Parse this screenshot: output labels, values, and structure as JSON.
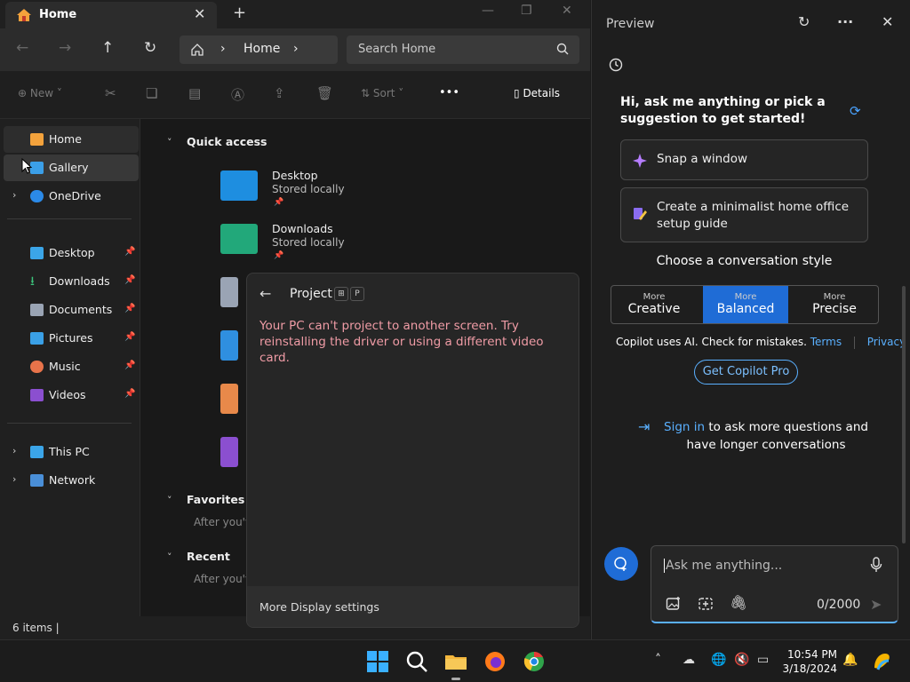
{
  "explorer": {
    "tab_title": "Home",
    "address": {
      "root": "Home"
    },
    "search_placeholder": "Search Home",
    "toolbar": {
      "new": "New",
      "sort": "Sort",
      "more": "•••",
      "details": "Details"
    },
    "nav": {
      "top": [
        {
          "label": "Home"
        },
        {
          "label": "Gallery"
        },
        {
          "label": "OneDrive"
        }
      ],
      "pinned": [
        {
          "label": "Desktop"
        },
        {
          "label": "Downloads"
        },
        {
          "label": "Documents"
        },
        {
          "label": "Pictures"
        },
        {
          "label": "Music"
        },
        {
          "label": "Videos"
        }
      ],
      "bottom": [
        {
          "label": "This PC"
        },
        {
          "label": "Network"
        }
      ]
    },
    "quick_access": {
      "title": "Quick access",
      "items": [
        {
          "name": "Desktop",
          "sub": "Stored locally"
        },
        {
          "name": "Downloads",
          "sub": "Stored locally"
        }
      ]
    },
    "favorites": {
      "title": "Favorites",
      "sub": "After you'v"
    },
    "recent": {
      "title": "Recent",
      "sub": "After you'v"
    },
    "status": "6 items  |"
  },
  "project": {
    "title": "Project",
    "key": "P",
    "error": "Your PC can't project to another screen. Try reinstalling the driver or using a different video card.",
    "footer": "More Display settings"
  },
  "copilot": {
    "title": "Preview",
    "more": "···",
    "greeting": "Hi, ask me anything or pick a suggestion to get started!",
    "suggestions": [
      {
        "text": "Snap a window"
      },
      {
        "text": "Create a minimalist home office setup guide"
      }
    ],
    "style_title": "Choose a conversation style",
    "styles": [
      {
        "more": "More",
        "name": "Creative"
      },
      {
        "more": "More",
        "name": "Balanced"
      },
      {
        "more": "More",
        "name": "Precise"
      }
    ],
    "selected_style": "Balanced",
    "disclaimer": "Copilot uses AI. Check for mistakes.",
    "terms": "Terms",
    "privacy": "Privacy",
    "pro_button": "Get Copilot Pro",
    "signin_link": "Sign in",
    "signin_text": " to ask more questions and have longer conversations",
    "input_placeholder": "Ask me anything...",
    "char_count": "0/2000"
  },
  "taskbar": {
    "time": "10:54 PM",
    "date": "3/18/2024"
  },
  "colors": {
    "accent": "#1f6cd6",
    "link": "#5ab0ff",
    "error": "#f09ca6"
  }
}
